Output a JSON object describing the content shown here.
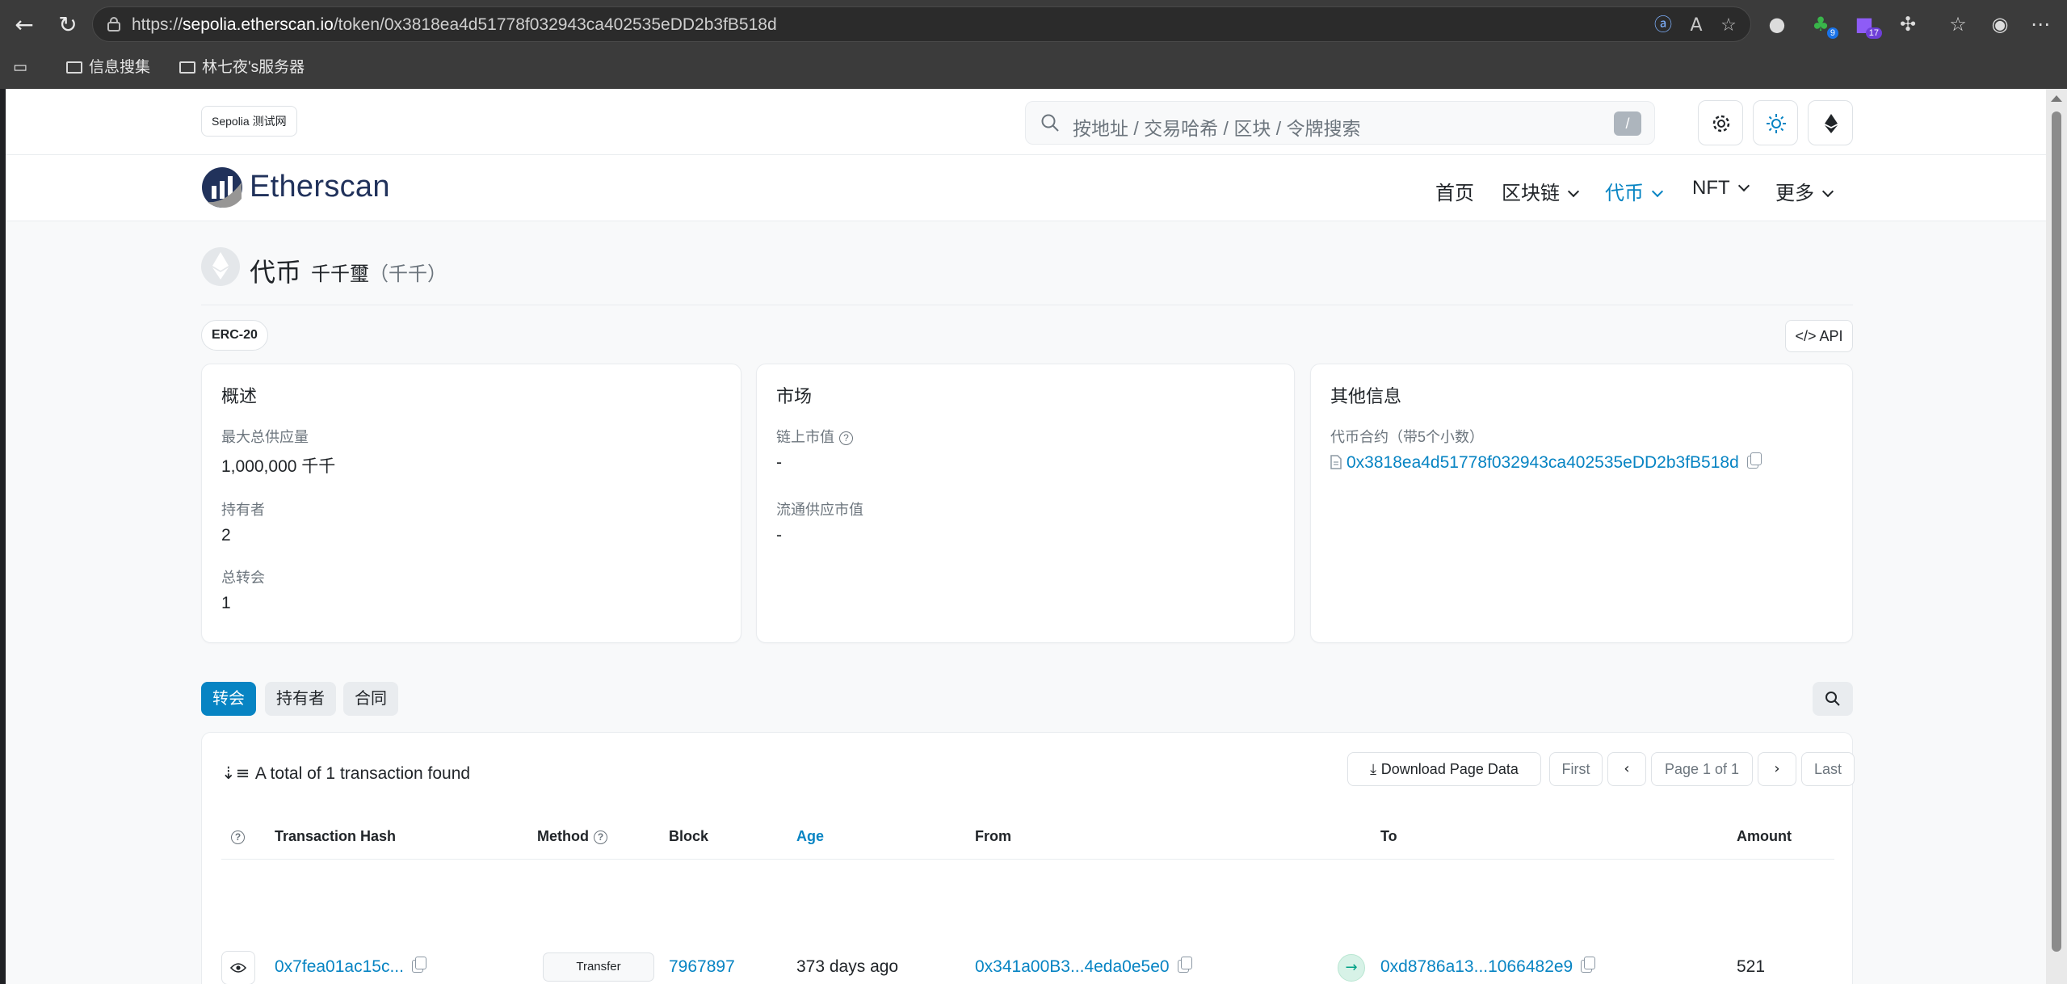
{
  "browser": {
    "url_prefix": "https://",
    "url_host": "sepolia.etherscan.io",
    "url_path": "/token/0x3818ea4d51778f032943ca402535eDD2b3fB518d",
    "ext_badges": [
      "9",
      "17"
    ],
    "bookmarks": [
      {
        "label": "信息搜集"
      },
      {
        "label": "林七夜's服务器"
      }
    ]
  },
  "site": {
    "network_badge": "Sepolia 测试网",
    "search_placeholder": "按地址 / 交易哈希 / 区块 / 令牌搜索",
    "search_shortcut": "/",
    "logo_text": "Etherscan",
    "nav": [
      {
        "label": "首页"
      },
      {
        "label": "区块链"
      },
      {
        "label": "代币"
      },
      {
        "label": "NFT"
      },
      {
        "label": "更多"
      }
    ],
    "accent_color": "#0784c3"
  },
  "token": {
    "heading": "代币",
    "name": "千千璽",
    "symbol": "（千千）",
    "standard_badge": "ERC-20",
    "api_label": "API"
  },
  "overview": {
    "title": "概述",
    "max_supply_label": "最大总供应量",
    "max_supply_value": "1,000,000 千千",
    "holders_label": "持有者",
    "holders_value": "2",
    "transfers_label": "总转会",
    "transfers_value": "1"
  },
  "market": {
    "title": "市场",
    "onchain_mcap_label": "链上市值",
    "onchain_mcap_value": "-",
    "circ_mcap_label": "流通供应市值",
    "circ_mcap_value": "-"
  },
  "other_info": {
    "title": "其他信息",
    "contract_label": "代币合约（带5个小数）",
    "contract_address": "0x3818ea4d51778f032943ca402535eDD2b3fB518d"
  },
  "tabs": [
    {
      "label": "转会",
      "active": true
    },
    {
      "label": "持有者",
      "active": false
    },
    {
      "label": "合同",
      "active": false
    }
  ],
  "transactions": {
    "summary": "A total of 1 transaction found",
    "download_label": "Download Page Data",
    "pager": {
      "first": "First",
      "page": "Page 1 of 1",
      "last": "Last"
    },
    "columns": {
      "hash": "Transaction Hash",
      "method": "Method",
      "block": "Block",
      "age": "Age",
      "from": "From",
      "to": "To",
      "amount": "Amount"
    },
    "rows": [
      {
        "hash": "0x7fea01ac15c...",
        "method": "Transfer",
        "block": "7967897",
        "age": "373 days ago",
        "from": "0x341a00B3...4eda0e5e0",
        "to": "0xd8786a13...1066482e9",
        "amount": "521"
      }
    ]
  }
}
